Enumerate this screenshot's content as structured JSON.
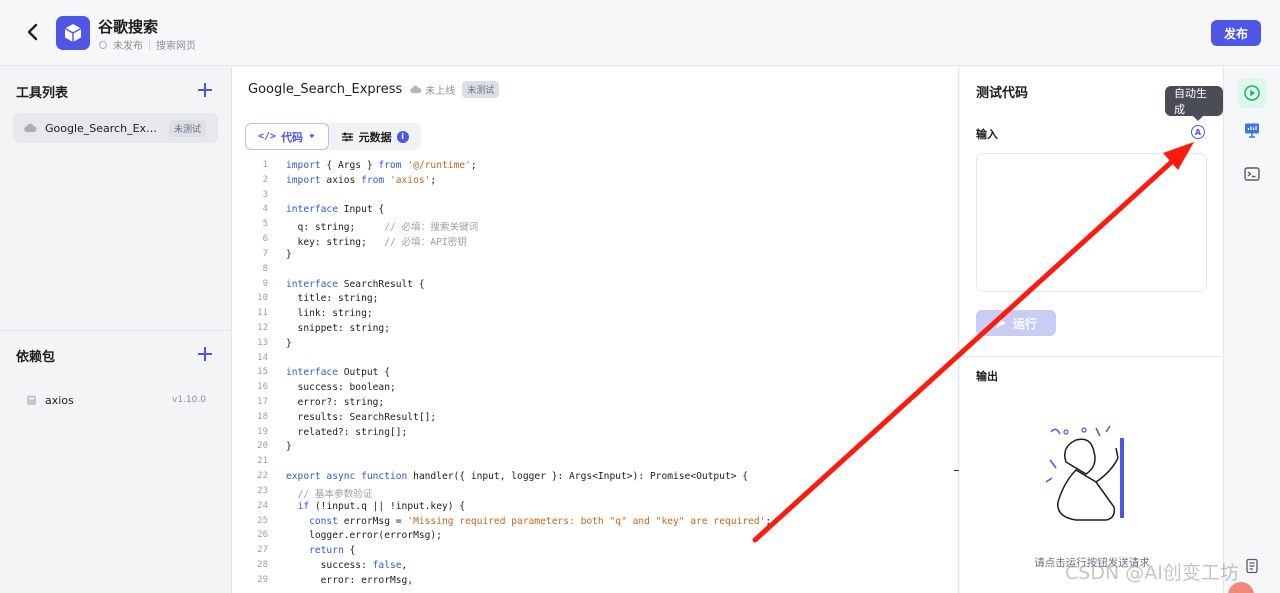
{
  "header": {
    "app_title": "谷歌搜索",
    "status": "未发布",
    "category": "搜索网页",
    "publish_label": "发布"
  },
  "sidebar": {
    "tools_title": "工具列表",
    "tools": [
      {
        "name": "Google_Search_Expr...",
        "badge": "未测试"
      }
    ],
    "deps_title": "依赖包",
    "deps": [
      {
        "name": "axios",
        "version": "v1.10.0"
      }
    ]
  },
  "editor": {
    "tool_name": "Google_Search_Express",
    "online_status": "未上线",
    "test_status": "未测试",
    "tabs": [
      {
        "label": "代码",
        "active": true
      },
      {
        "label": "元数据",
        "active": false,
        "info": "i"
      }
    ],
    "code_lines": [
      {
        "n": "1",
        "html": "<span class=\"kw\">import</span> { Args } <span class=\"kw\">from</span> <span class=\"str\">'@/runtime'</span>;"
      },
      {
        "n": "2",
        "html": "<span class=\"kw\">import</span> axios <span class=\"kw\">from</span> <span class=\"str\">'axios'</span>;"
      },
      {
        "n": "3",
        "html": ""
      },
      {
        "n": "4",
        "html": "<span class=\"kw\">interface</span> Input {"
      },
      {
        "n": "5",
        "html": "  q: string;     <span class=\"cm\">// 必填：搜索关键词</span>"
      },
      {
        "n": "6",
        "html": "  key: string;   <span class=\"cm\">// 必填：API密钥</span>"
      },
      {
        "n": "7",
        "html": "}"
      },
      {
        "n": "8",
        "html": ""
      },
      {
        "n": "9",
        "html": "<span class=\"kw\">interface</span> SearchResult {"
      },
      {
        "n": "10",
        "html": "  title: string;"
      },
      {
        "n": "11",
        "html": "  link: string;"
      },
      {
        "n": "12",
        "html": "  snippet: string;"
      },
      {
        "n": "13",
        "html": "}"
      },
      {
        "n": "14",
        "html": ""
      },
      {
        "n": "15",
        "html": "<span class=\"kw\">interface</span> Output {"
      },
      {
        "n": "16",
        "html": "  success: boolean;"
      },
      {
        "n": "17",
        "html": "  error?: string;"
      },
      {
        "n": "18",
        "html": "  results: SearchResult[];"
      },
      {
        "n": "19",
        "html": "  related?: string[];"
      },
      {
        "n": "20",
        "html": "}"
      },
      {
        "n": "21",
        "html": ""
      },
      {
        "n": "22",
        "html": "<span class=\"kw\">export async function</span> handler({ input, logger }: Args&lt;Input&gt;): Promise&lt;Output&gt; {"
      },
      {
        "n": "23",
        "html": "  <span class=\"cm\">// 基本参数验证</span>"
      },
      {
        "n": "24",
        "html": "  <span class=\"kw\">if</span> (!input.q || !input.key) {"
      },
      {
        "n": "25",
        "html": "    <span class=\"kw\">const</span> errorMsg = <span class=\"str\">'Missing required parameters: both \"q\" and \"key\" are required'</span>;"
      },
      {
        "n": "26",
        "html": "    logger.error(errorMsg);"
      },
      {
        "n": "27",
        "html": "    <span class=\"kw\">return</span> {"
      },
      {
        "n": "28",
        "html": "      success: <span class=\"kw\">false</span>,"
      },
      {
        "n": "29",
        "html": "      error: errorMsg,"
      }
    ]
  },
  "test_panel": {
    "title": "测试代码",
    "input_label": "输入",
    "auto_generate_tooltip": "自动生成",
    "auto_icon_letter": "A",
    "run_label": "运行",
    "output_label": "输出",
    "empty_hint": "请点击运行按钮发送请求"
  },
  "watermark": "CSDN @AI创变工坊",
  "colors": {
    "accent": "#4e56e6",
    "annotation_arrow": "#ff1a0f"
  }
}
